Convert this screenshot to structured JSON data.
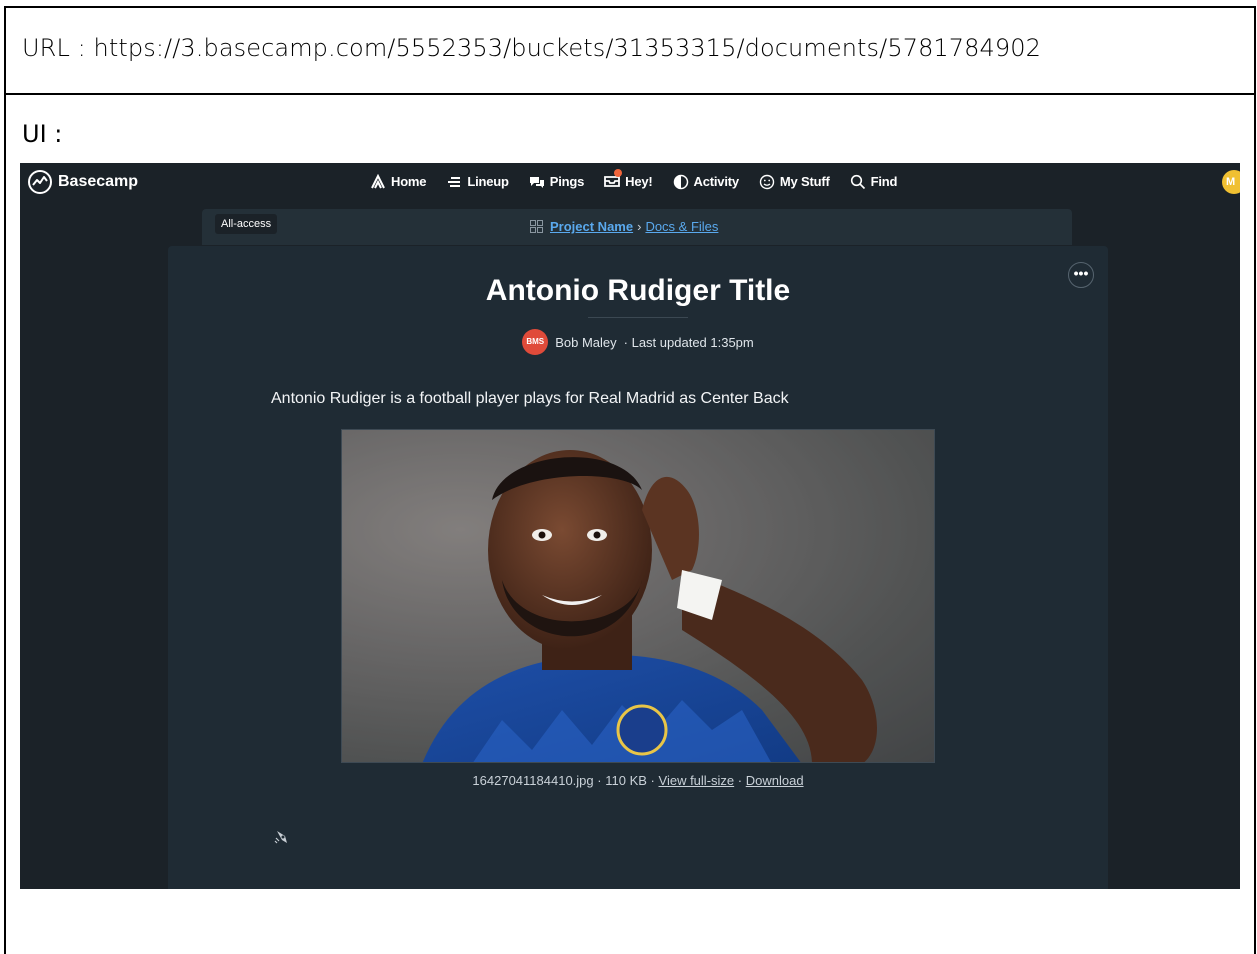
{
  "annotation": {
    "url_line": "URL : https://3.basecamp.com/5552353/buckets/31353315/documents/5781784902",
    "ui_label": "UI :"
  },
  "app": {
    "name": "Basecamp",
    "nav": [
      {
        "label": "Home",
        "icon": "home-icon"
      },
      {
        "label": "Lineup",
        "icon": "lineup-icon"
      },
      {
        "label": "Pings",
        "icon": "pings-icon"
      },
      {
        "label": "Hey!",
        "icon": "hey-icon"
      },
      {
        "label": "Activity",
        "icon": "activity-icon"
      },
      {
        "label": "My Stuff",
        "icon": "my-stuff-icon"
      },
      {
        "label": "Find",
        "icon": "search-icon"
      }
    ],
    "user_avatar_initial": "M"
  },
  "breadcrumb": {
    "all_access": "All-access",
    "project": "Project Name",
    "separator": "›",
    "section": "Docs & Files"
  },
  "document": {
    "title": "Antonio Rudiger Title",
    "author_initials": "BMS",
    "author": "Bob Maley",
    "updated": "· Last updated 1:35pm",
    "body": "Antonio Rudiger is a football player plays for Real Madrid as Center Back",
    "image": {
      "filename": "16427041184410.jpg",
      "size": "110 KB",
      "view_full": "View full-size",
      "download": "Download"
    }
  },
  "colors": {
    "background": "#1b2228",
    "card": "#1f2b34",
    "link": "#5aa9ee",
    "author_avatar": "#e04b3a",
    "user_avatar": "#f0c032"
  }
}
